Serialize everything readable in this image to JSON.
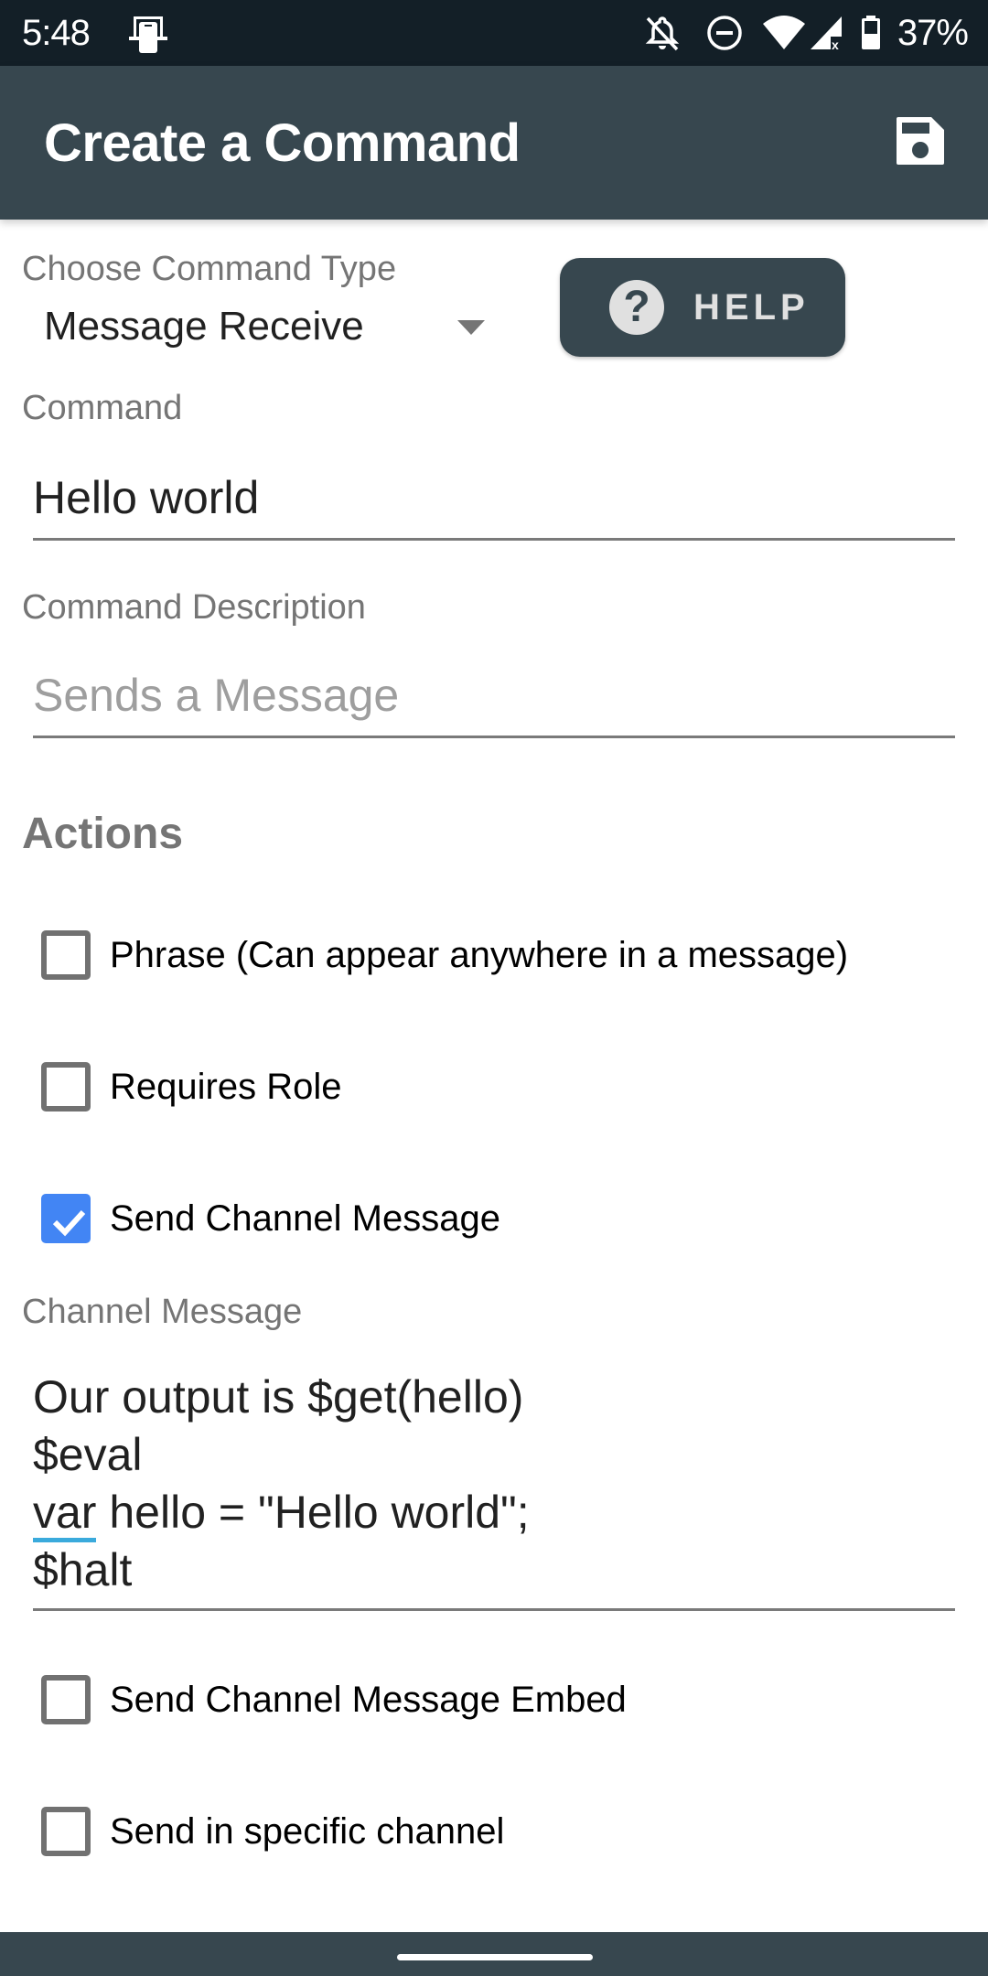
{
  "status_bar": {
    "time": "5:48",
    "battery": "37%",
    "icons": [
      "screen-mirror-icon",
      "notifications-off-icon",
      "do-not-disturb-icon",
      "wifi-icon",
      "cell-signal-no-data-icon",
      "battery-icon"
    ]
  },
  "app_bar": {
    "title": "Create a Command",
    "save_icon": "save-icon"
  },
  "form": {
    "command_type": {
      "label": "Choose Command Type",
      "value": "Message Receive"
    },
    "help_button": {
      "label": "HELP",
      "icon": "help-icon"
    },
    "command": {
      "label": "Command",
      "value": "Hello world"
    },
    "description": {
      "label": "Command Description",
      "placeholder": "Sends a Message"
    },
    "actions": {
      "title": "Actions",
      "items": [
        {
          "label": "Phrase (Can appear anywhere in a message)",
          "checked": false
        },
        {
          "label": "Requires Role",
          "checked": false
        },
        {
          "label": "Send Channel Message",
          "checked": true
        },
        {
          "label": "Send Channel Message Embed",
          "checked": false
        },
        {
          "label": "Send in specific channel",
          "checked": false
        }
      ]
    },
    "channel_message": {
      "label": "Channel Message",
      "lines": [
        "Our output is $get(hello)",
        "$eval",
        "hello = \"Hello world\";",
        "$halt"
      ],
      "spellcheck_word": "var"
    }
  },
  "colors": {
    "status_bar": "#131f27",
    "primary": "#37474f",
    "accent_checkbox": "#4285f4",
    "spellcheck_underline": "#3aaadc"
  }
}
